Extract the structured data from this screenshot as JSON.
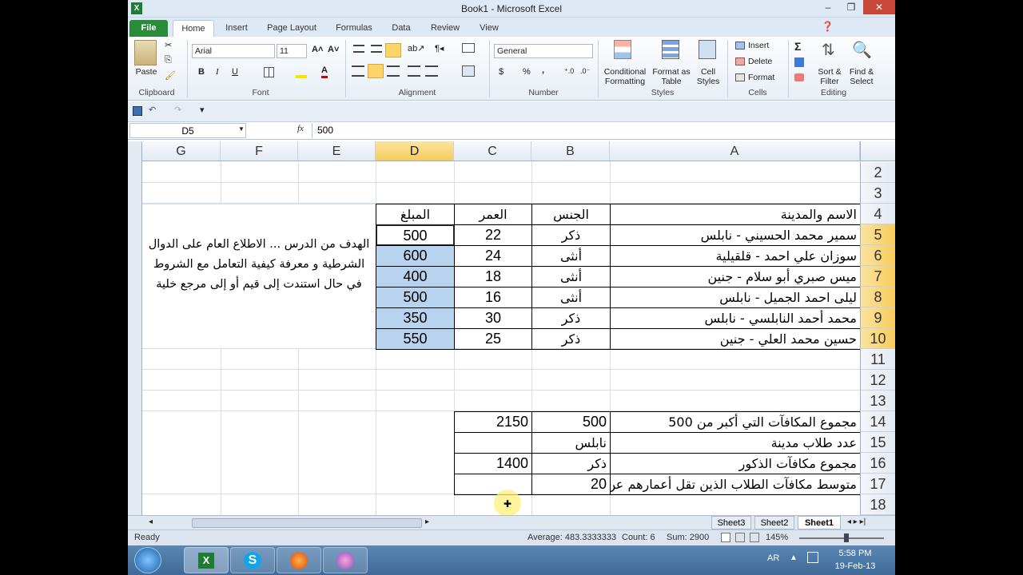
{
  "window": {
    "title": "Book1 - Microsoft Excel",
    "minimize": "–",
    "restore": "❐",
    "close": "✕"
  },
  "tabs": [
    "File",
    "Home",
    "Insert",
    "Page Layout",
    "Formulas",
    "Data",
    "Review",
    "View"
  ],
  "ribbon": {
    "clipboard": {
      "paste": "Paste",
      "label": "Clipboard"
    },
    "font": {
      "name": "Arial",
      "size": "11",
      "bold": "B",
      "italic": "I",
      "underline": "U",
      "label": "Font"
    },
    "alignment": {
      "label": "Alignment"
    },
    "number": {
      "format": "General",
      "currency": "$",
      "percent": "%",
      "comma": ",",
      "label": "Number"
    },
    "styles": {
      "conditional": "Conditional Formatting",
      "format_table": "Format as Table",
      "cell_styles": "Cell Styles",
      "label": "Styles"
    },
    "cells": {
      "insert": "Insert",
      "delete": "Delete",
      "format": "Format",
      "label": "Cells"
    },
    "editing": {
      "sort": "Sort & Filter",
      "find": "Find & Select",
      "label": "Editing",
      "sum": "Σ"
    }
  },
  "formula_bar": {
    "name_box": "D5",
    "fx": "fx",
    "value": "500"
  },
  "columns": [
    "G",
    "F",
    "E",
    "D",
    "C",
    "B",
    "A"
  ],
  "selected_column": "D",
  "rows": [
    "2",
    "3",
    "4",
    "5",
    "6",
    "7",
    "8",
    "9",
    "10",
    "11",
    "12",
    "13",
    "14",
    "15",
    "16",
    "17",
    "18"
  ],
  "table": {
    "headers": {
      "name": "الاسم والمدينة",
      "gender": "الجنس",
      "age": "العمر",
      "amount": "المبلغ"
    },
    "records": [
      {
        "name": "سمير محمد الحسيني - نابلس",
        "gender": "ذكر",
        "age": "22",
        "amount": "500"
      },
      {
        "name": "سوزان علي احمد - قلقيلية",
        "gender": "أنثى",
        "age": "24",
        "amount": "600"
      },
      {
        "name": "ميس صبري أبو سلام - جنين",
        "gender": "أنثى",
        "age": "18",
        "amount": "400"
      },
      {
        "name": "ليلى احمد الجميل - نابلس",
        "gender": "أنثى",
        "age": "16",
        "amount": "500"
      },
      {
        "name": "محمد أحمد النابلسي - نابلس",
        "gender": "ذكر",
        "age": "30",
        "amount": "350"
      },
      {
        "name": "حسين محمد العلي - جنين",
        "gender": "ذكر",
        "age": "25",
        "amount": "550"
      }
    ]
  },
  "note": "الهدف من الدرس ... الاطلاع العام على الدوال الشرطية و معرفة كيفية التعامل مع الشروط في حال استندت إلى قيم أو إلى مرجع خلية",
  "summary": [
    {
      "label": "مجموع المكافآت التي أكبر من 500",
      "criterion": "500",
      "result": "2150"
    },
    {
      "label": "عدد  طلاب مدينة",
      "criterion": "نابلس",
      "result": ""
    },
    {
      "label": "مجموع مكافآت الذكور",
      "criterion": "ذكر",
      "result": "1400"
    },
    {
      "label": "متوسط مكافآت الطلاب الذين تقل أعمارهم عن",
      "criterion": "20",
      "result": ""
    }
  ],
  "sheets": [
    "Sheet3",
    "Sheet2",
    "Sheet1"
  ],
  "status": {
    "ready": "Ready",
    "average": "Average: 483.3333333",
    "count": "Count: 6",
    "sum": "Sum: 2900",
    "zoom": "145%"
  },
  "taskbar": {
    "lang": "AR",
    "time": "5:58 PM",
    "date": "19-Feb-13"
  },
  "colors": {
    "selection": "#b8d3ee",
    "header_selected": "#f7cb5d",
    "file_tab": "#2a8c3a"
  }
}
